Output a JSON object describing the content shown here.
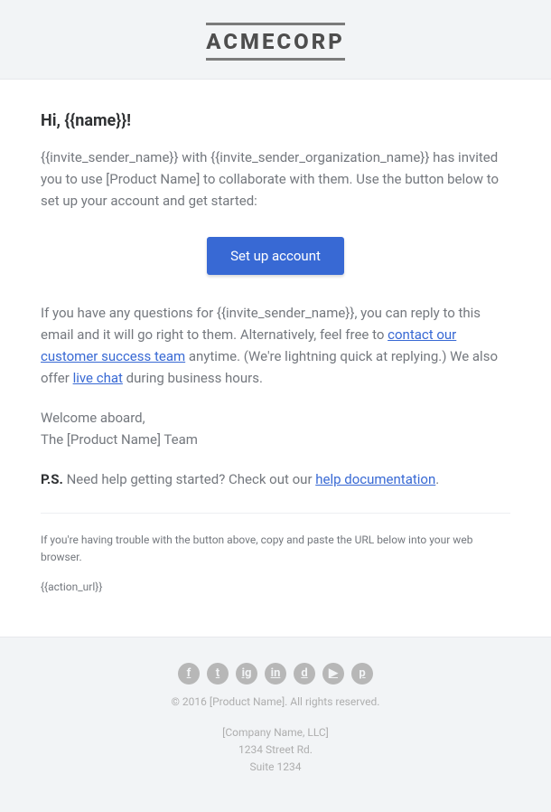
{
  "header": {
    "logo": "ACMECORP"
  },
  "body": {
    "greeting": "Hi, {{name}}!",
    "intro": "{{invite_sender_name}} with {{invite_sender_organization_name}} has invited you to use [Product Name] to collaborate with them. Use the button below to set up your account and get started:",
    "cta_label": "Set up account",
    "help": {
      "p1": "If you have any questions for {{invite_sender_name}}, you can reply to this email and it will go right to them. Alternatively, feel free to ",
      "link1": "contact our customer success team",
      "p2": " anytime. (We're lightning quick at replying.) We also offer ",
      "link2": "live chat",
      "p3": " during business hours."
    },
    "signoff": {
      "l1": "Welcome aboard,",
      "l2": "The [Product Name] Team"
    },
    "ps": {
      "label": "P.S.",
      "text": " Need help getting started? Check out our ",
      "link": "help documentation",
      "tail": "."
    },
    "subcopy": {
      "text": "If you're having trouble with the button above, copy and paste the URL below into your web browser.",
      "url": "{{action_url}}"
    }
  },
  "footer": {
    "social": [
      {
        "name": "facebook-icon",
        "glyph": "f"
      },
      {
        "name": "twitter-icon",
        "glyph": "t"
      },
      {
        "name": "instagram-icon",
        "glyph": "ig"
      },
      {
        "name": "linkedin-icon",
        "glyph": "in"
      },
      {
        "name": "dribbble-icon",
        "glyph": "d"
      },
      {
        "name": "youtube-icon",
        "glyph": "▶"
      },
      {
        "name": "pinterest-icon",
        "glyph": "p"
      }
    ],
    "copyright": "© 2016 [Product Name]. All rights reserved.",
    "address": {
      "l1": "[Company Name, LLC]",
      "l2": "1234 Street Rd.",
      "l3": "Suite 1234"
    }
  }
}
